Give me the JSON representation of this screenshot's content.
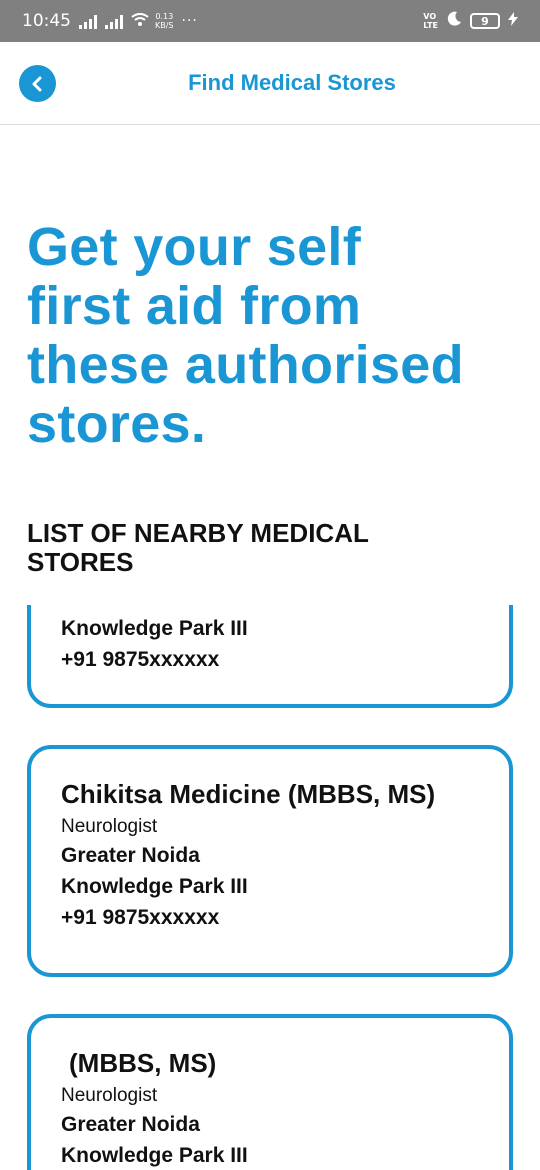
{
  "status_bar": {
    "time": "10:45",
    "speed_value": "0.13",
    "speed_unit": "KB/S",
    "more": "···",
    "volte_top": "VO",
    "volte_bottom": "LTE",
    "battery": "9"
  },
  "header": {
    "title": "Find Medical Stores",
    "back_icon": "chevron-left-icon"
  },
  "hero": {
    "line1": "Get your self",
    "line2": "first aid from",
    "line3": "these authorised",
    "line4": "stores."
  },
  "section": {
    "title_line1": "LIST OF NEARBY MEDICAL",
    "title_line2": "STORES"
  },
  "stores": [
    {
      "line1": "Knowledge Park III",
      "phone": "+91 9875xxxxxx"
    },
    {
      "name": "Chikitsa Medicine (MBBS, MS)",
      "specialty": "Neurologist",
      "line1": "Greater Noida",
      "line2": "Knowledge Park III",
      "phone": "+91 9875xxxxxx"
    },
    {
      "name": " (MBBS, MS)",
      "specialty": "Neurologist",
      "line1": "Greater Noida",
      "line2": "Knowledge Park III"
    }
  ],
  "colors": {
    "accent": "#1a96d4",
    "status_bar": "#808080",
    "text": "#111111"
  }
}
